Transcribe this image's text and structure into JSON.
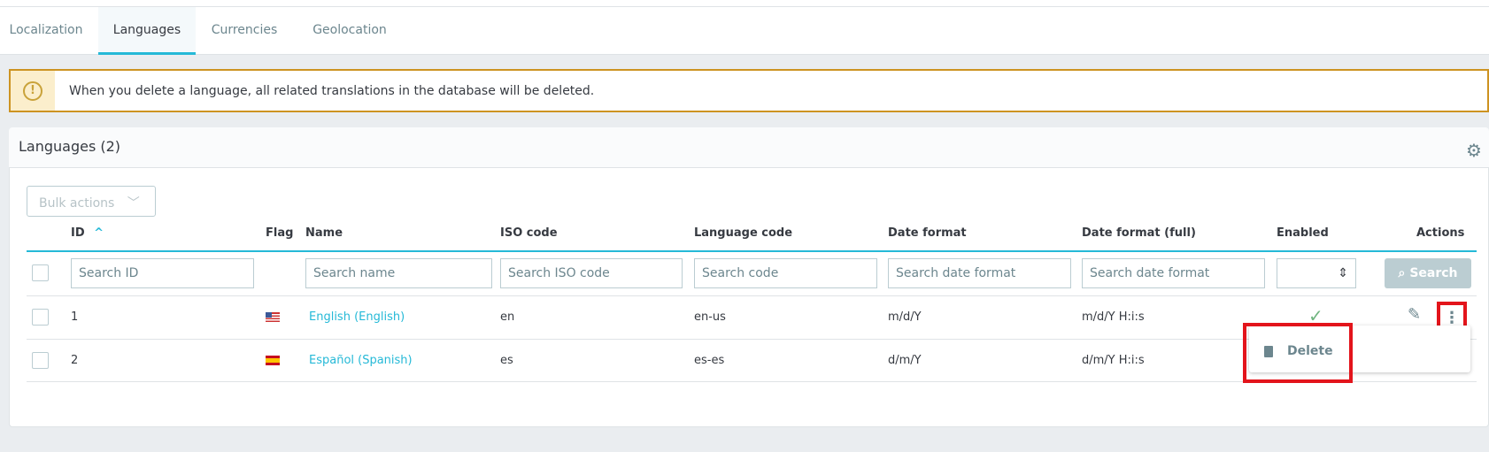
{
  "tabs": [
    {
      "label": "Localization"
    },
    {
      "label": "Languages",
      "active": true
    },
    {
      "label": "Currencies"
    },
    {
      "label": "Geolocation"
    }
  ],
  "alert": {
    "icon": "warning-circle-icon",
    "message": "When you delete a language, all related translations in the database will be deleted."
  },
  "card": {
    "title": "Languages (2)",
    "settings_icon": "gear-icon",
    "bulk_actions": "Bulk actions"
  },
  "table": {
    "columns": [
      "ID",
      "Flag",
      "Name",
      "ISO code",
      "Language code",
      "Date format",
      "Date format (full)",
      "Enabled",
      "Actions"
    ],
    "sort": {
      "column": "ID",
      "direction": "asc"
    },
    "filters": {
      "id": "Search ID",
      "name": "Search name",
      "iso": "Search ISO code",
      "code": "Search code",
      "date": "Search date format",
      "date_full": "Search date format",
      "search_button": "Search"
    },
    "rows": [
      {
        "id": "1",
        "flag": "us",
        "name": "English (English)",
        "iso": "en",
        "code": "en-us",
        "date": "m/d/Y",
        "date_full": "m/d/Y H:i:s",
        "enabled": true
      },
      {
        "id": "2",
        "flag": "es",
        "name": "Español (Spanish)",
        "iso": "es",
        "code": "es-es",
        "date": "d/m/Y",
        "date_full": "d/m/Y H:i:s",
        "enabled": null
      }
    ]
  },
  "dropdown": {
    "items": [
      {
        "label": "Delete",
        "icon": "trash-icon"
      }
    ]
  },
  "colors": {
    "accent": "#25b9d7",
    "highlight": "#e3141b",
    "warning": "#cd9321",
    "enabled": "#70b580"
  }
}
